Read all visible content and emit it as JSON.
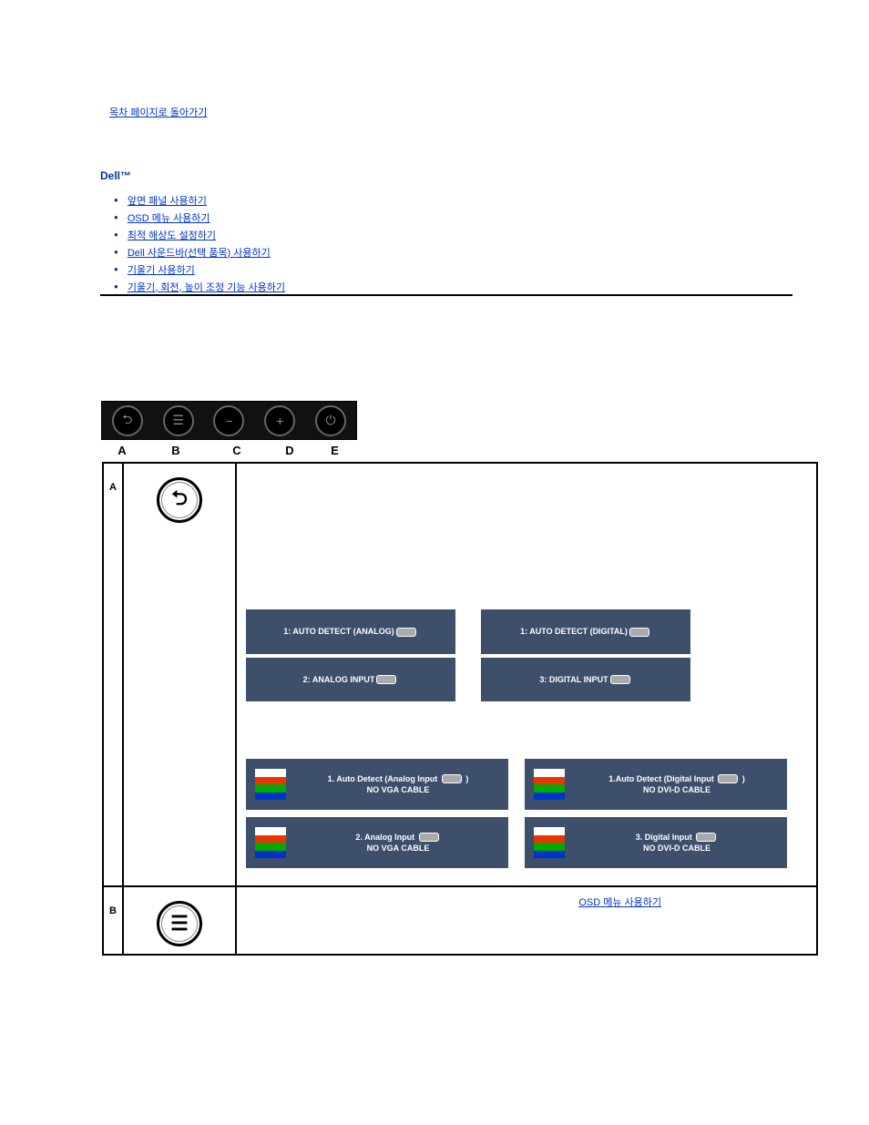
{
  "top_link": "목차 페이지로 돌아가기",
  "brand": "Dell™",
  "bullets": [
    "앞면 패널 사용하기",
    "OSD 메뉴 사용하기",
    "최적 해상도 설정하기",
    "Dell 사운드바(선택 품목) 사용하기",
    "기울기 사용하기",
    "기울기, 회전, 높이 조정 기능 사용하기"
  ],
  "button_labels": [
    "A",
    "B",
    "C",
    "D",
    "E"
  ],
  "buttons": [
    "⮌",
    "☰",
    "−",
    "+",
    "⏻"
  ],
  "rowA": {
    "letter": "A",
    "osd1": [
      {
        "label": "1: AUTO DETECT (ANALOG)"
      },
      {
        "label": "2: ANALOG INPUT"
      }
    ],
    "osd2": [
      {
        "label": "1: AUTO DETECT (DIGITAL)"
      },
      {
        "label": "3: DIGITAL INPUT"
      }
    ],
    "osd3": [
      {
        "line1": "1. Auto Detect (Analog Input",
        "line2": "NO VGA CABLE",
        "paren": ")"
      },
      {
        "line1": "2. Analog  Input",
        "line2": "NO VGA CABLE"
      }
    ],
    "osd4": [
      {
        "line1": "1.Auto Detect (Digital  Input",
        "line2": "NO DVI-D CABLE",
        "paren": ")"
      },
      {
        "line1": "3.  Digital  Input",
        "line2": "NO DVI-D CABLE"
      }
    ]
  },
  "rowB": {
    "letter": "B",
    "link": "OSD 메뉴 사용하기"
  }
}
